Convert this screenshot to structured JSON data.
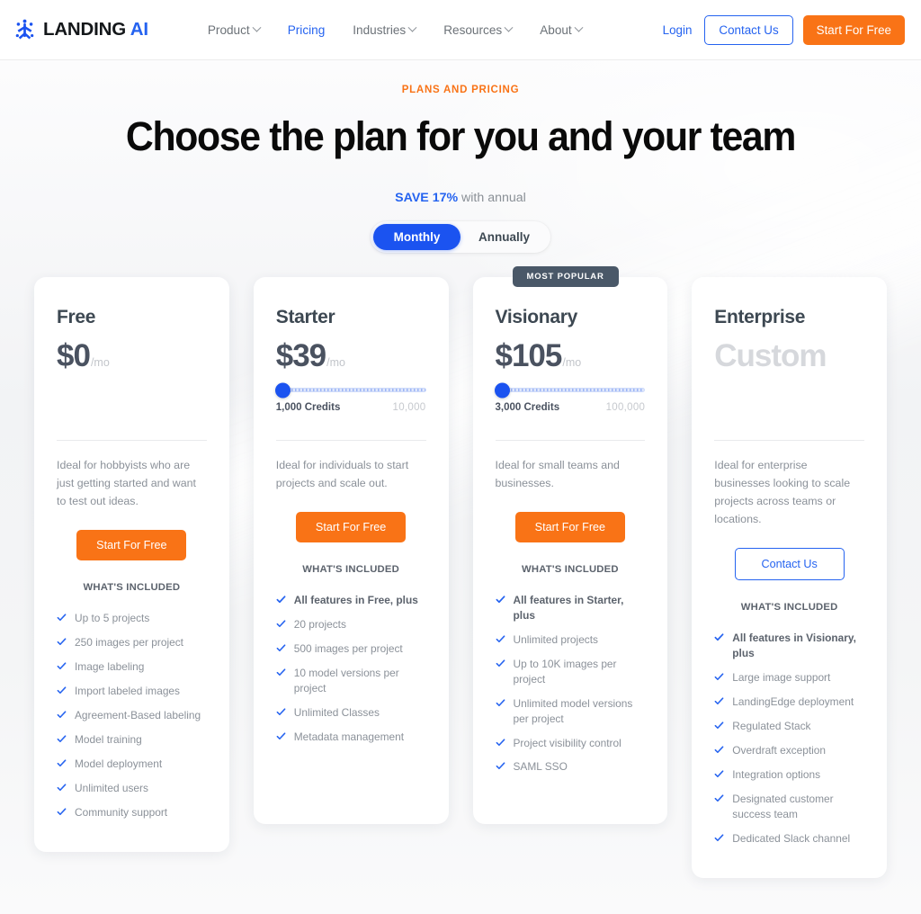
{
  "colors": {
    "brand_blue": "#2563f0",
    "accent_orange": "#f97316",
    "badge_slate": "#4a5868",
    "toggle_active": "#1b53f0",
    "text_muted": "#8b9199"
  },
  "nav": {
    "brand_main": "LANDING",
    "brand_accent": "AI",
    "links": [
      {
        "label": "Product",
        "has_caret": true,
        "active": false
      },
      {
        "label": "Pricing",
        "has_caret": false,
        "active": true
      },
      {
        "label": "Industries",
        "has_caret": true,
        "active": false
      },
      {
        "label": "Resources",
        "has_caret": true,
        "active": false
      },
      {
        "label": "About",
        "has_caret": true,
        "active": false
      }
    ],
    "login_label": "Login",
    "contact_label": "Contact Us",
    "start_label": "Start For Free"
  },
  "hero": {
    "eyebrow": "PLANS AND PRICING",
    "headline": "Choose the plan for you and your team",
    "save_strong": "SAVE 17%",
    "save_rest": " with annual",
    "toggle": {
      "options": [
        "Monthly",
        "Annually"
      ],
      "selected": "Monthly"
    }
  },
  "included_heading": "WHAT'S INCLUDED",
  "plans": [
    {
      "name": "Free",
      "price": "$0",
      "per": "/mo",
      "badge": null,
      "slider": null,
      "blurb": "Ideal for hobbyists who are just getting started and want to test out ideas.",
      "cta_label": "Start For Free",
      "cta_style": "orange",
      "features": [
        {
          "text": "Up to 5 projects",
          "bold": false
        },
        {
          "text": "250 images per project",
          "bold": false
        },
        {
          "text": "Image labeling",
          "bold": false
        },
        {
          "text": "Import labeled images",
          "bold": false
        },
        {
          "text": "Agreement-Based labeling",
          "bold": false
        },
        {
          "text": "Model training",
          "bold": false
        },
        {
          "text": "Model deployment",
          "bold": false
        },
        {
          "text": "Unlimited users",
          "bold": false
        },
        {
          "text": "Community support",
          "bold": false
        }
      ]
    },
    {
      "name": "Starter",
      "price": "$39",
      "per": "/mo",
      "badge": null,
      "slider": {
        "current_label": "1,000 Credits",
        "max_label": "10,000",
        "position_pct": 0
      },
      "blurb": "Ideal for individuals to start projects and scale out.",
      "cta_label": "Start For Free",
      "cta_style": "orange",
      "features": [
        {
          "text": "All features in Free, plus",
          "bold": true
        },
        {
          "text": "20 projects",
          "bold": false
        },
        {
          "text": "500 images per project",
          "bold": false
        },
        {
          "text": "10 model versions per project",
          "bold": false
        },
        {
          "text": "Unlimited Classes",
          "bold": false
        },
        {
          "text": "Metadata management",
          "bold": false
        }
      ]
    },
    {
      "name": "Visionary",
      "price": "$105",
      "per": "/mo",
      "badge": "MOST POPULAR",
      "slider": {
        "current_label": "3,000 Credits",
        "max_label": "100,000",
        "position_pct": 0
      },
      "blurb": "Ideal for small teams and businesses.",
      "cta_label": "Start For Free",
      "cta_style": "orange",
      "features": [
        {
          "text": "All features in Starter, plus",
          "bold": true
        },
        {
          "text": "Unlimited projects",
          "bold": false
        },
        {
          "text": "Up to 10K images per project",
          "bold": false
        },
        {
          "text": "Unlimited model versions per project",
          "bold": false
        },
        {
          "text": "Project visibility control",
          "bold": false
        },
        {
          "text": "SAML SSO",
          "bold": false
        }
      ]
    },
    {
      "name": "Enterprise",
      "price": "Custom",
      "per": "",
      "badge": null,
      "slider": null,
      "blurb": "Ideal for enterprise businesses looking to scale projects across teams or locations.",
      "cta_label": "Contact Us",
      "cta_style": "outline",
      "features": [
        {
          "text": "All features in Visionary, plus",
          "bold": true
        },
        {
          "text": "Large image support",
          "bold": false
        },
        {
          "text": "LandingEdge deployment",
          "bold": false
        },
        {
          "text": "Regulated Stack",
          "bold": false
        },
        {
          "text": "Overdraft exception",
          "bold": false
        },
        {
          "text": "Integration options",
          "bold": false
        },
        {
          "text": "Designated customer success team",
          "bold": false
        },
        {
          "text": "Dedicated Slack channel",
          "bold": false
        }
      ]
    }
  ]
}
